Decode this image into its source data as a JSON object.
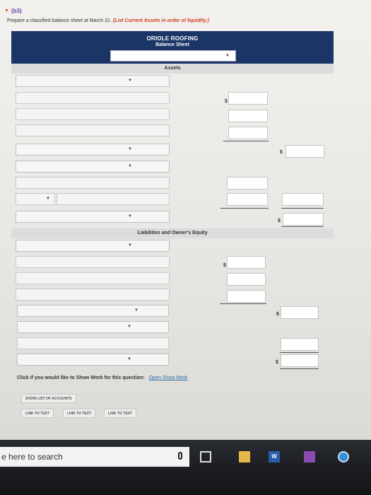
{
  "section": {
    "label": "(b3)"
  },
  "prompt": {
    "text": "Prepare a classified balance sheet at March 31.",
    "hint": "(List Current Assets in order of liquidity.)"
  },
  "header": {
    "company": "ORIOLE ROOFING",
    "title": "Balance Sheet",
    "date_value": ""
  },
  "bands": {
    "assets": "Assets",
    "liabilities": "Liabilities and Owner's Equity"
  },
  "currency": "$",
  "show_work": {
    "prompt": "Click if you would like to Show Work for this question:",
    "link": "Open Show Work"
  },
  "buttons": {
    "show_list": "SHOW LIST OF ACCOUNTS",
    "link1": "LINK TO TEXT",
    "link2": "LINK TO TEXT",
    "link3": "LINK TO TEXT"
  },
  "taskbar": {
    "search_placeholder": "e here to search",
    "word_label": "W"
  },
  "colors": {
    "header_bg": "#1b3566",
    "hint": "#d03a1a",
    "section": "#6a3fa2",
    "link": "#2b6ea6"
  },
  "icons": [
    "triangle-down-icon",
    "chevron-down-icon",
    "microphone-icon",
    "task-view-icon",
    "file-explorer-icon",
    "word-icon",
    "calendar-icon",
    "browser-icon"
  ]
}
